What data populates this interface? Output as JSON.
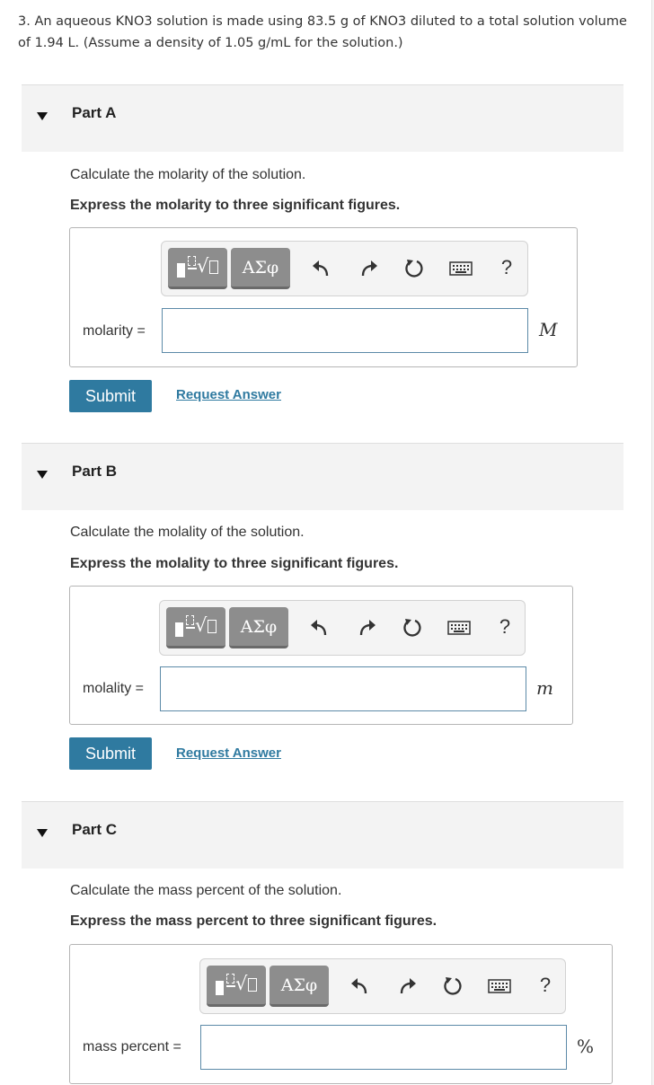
{
  "problem_text": "3. An aqueous KNO3 solution is made using 83.5 g of KNO3 diluted to a total solution volume of 1.94 L. (Assume a density of 1.05 g/mL for the solution.)",
  "toolbar": {
    "greek_label": "ΑΣφ",
    "help_label": "?"
  },
  "parts": [
    {
      "title": "Part A",
      "question": "Calculate the molarity of the solution.",
      "instruction": "Express the molarity to three significant figures.",
      "input_label": "molarity =",
      "input_value": "",
      "unit": "M",
      "submit_label": "Submit",
      "request_label": "Request Answer"
    },
    {
      "title": "Part B",
      "question": "Calculate the molality of the solution.",
      "instruction": "Express the molality to three significant figures.",
      "input_label": "molality =",
      "input_value": "",
      "unit": "m",
      "submit_label": "Submit",
      "request_label": "Request Answer"
    },
    {
      "title": "Part C",
      "question": "Calculate the mass percent of the solution.",
      "instruction": "Express the mass percent to three significant figures.",
      "input_label": "mass percent =",
      "input_value": "",
      "unit": "%"
    }
  ],
  "icons": {
    "caret": "caret-down-icon",
    "templates": "math-templates-icon",
    "undo": "undo-icon",
    "redo": "redo-icon",
    "reset": "reset-icon",
    "keyboard": "keyboard-icon",
    "help": "help-icon"
  }
}
